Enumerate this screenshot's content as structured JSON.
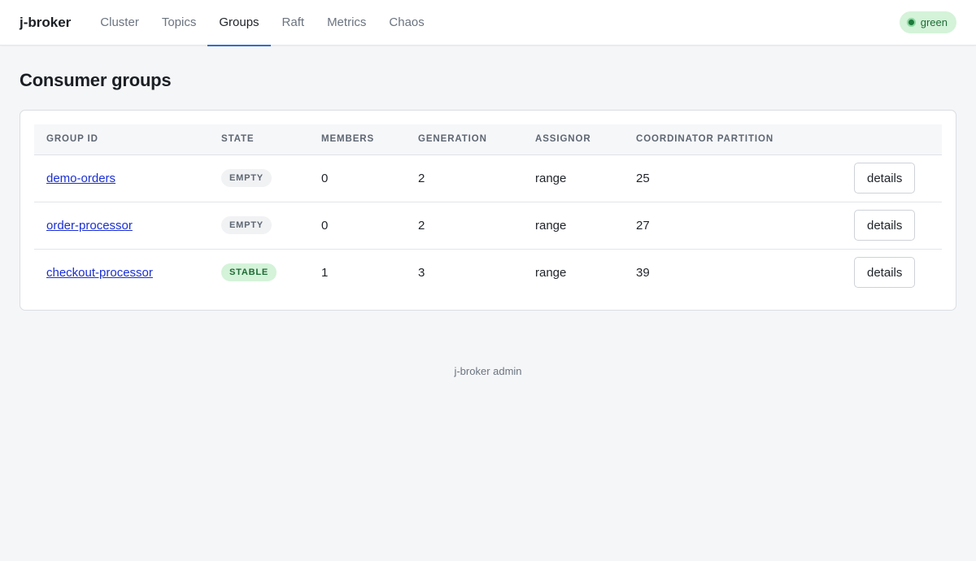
{
  "app": {
    "brand": "j-broker"
  },
  "nav": [
    {
      "label": "Cluster",
      "active": false
    },
    {
      "label": "Topics",
      "active": false
    },
    {
      "label": "Groups",
      "active": true
    },
    {
      "label": "Raft",
      "active": false
    },
    {
      "label": "Metrics",
      "active": false
    },
    {
      "label": "Chaos",
      "active": false
    }
  ],
  "status": {
    "label": "green",
    "color": "#1d7a3a"
  },
  "page": {
    "title": "Consumer groups"
  },
  "table": {
    "headers": [
      "GROUP ID",
      "STATE",
      "MEMBERS",
      "GENERATION",
      "ASSIGNOR",
      "COORDINATOR PARTITION",
      ""
    ],
    "rows": [
      {
        "group_id": "demo-orders",
        "state": "EMPTY",
        "members": "0",
        "generation": "2",
        "assignor": "range",
        "coordinator_partition": "25",
        "action": "details"
      },
      {
        "group_id": "order-processor",
        "state": "EMPTY",
        "members": "0",
        "generation": "2",
        "assignor": "range",
        "coordinator_partition": "27",
        "action": "details"
      },
      {
        "group_id": "checkout-processor",
        "state": "STABLE",
        "members": "1",
        "generation": "3",
        "assignor": "range",
        "coordinator_partition": "39",
        "action": "details"
      }
    ]
  },
  "footer": {
    "text": "j-broker admin"
  },
  "colors": {
    "accent": "#2f6fd6",
    "link": "#1a2fd4",
    "stable_bg": "#d4f3d9",
    "empty_bg": "#f1f2f4"
  }
}
